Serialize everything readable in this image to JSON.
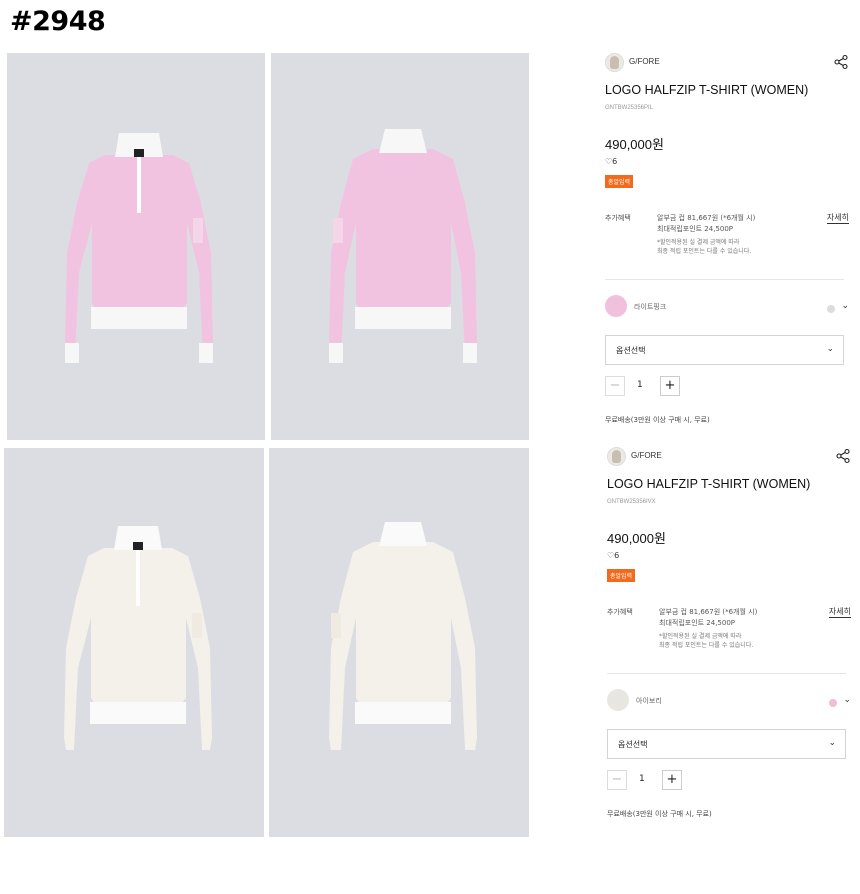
{
  "page_id": "#2948",
  "products": [
    {
      "brand": "G/FORE",
      "title": "LOGO HALFZIP T-SHIRT (WOMEN)",
      "code": "GNTBW25356PIL",
      "price": "490,000원",
      "likes": "6",
      "badge": "총알입력",
      "benefit_label": "추가혜택",
      "benefit_line1": "알부금 컵 81,667원 (*6개월 시)",
      "benefit_line2": "최대적립포인트 24,500P",
      "benefit_note1": "*할인적용된 실 결제 금액에 따라",
      "benefit_note2": "최종 적립 포인트는 다를 수 있습니다.",
      "detail_label": "자세히",
      "color_name": "라이트핑크",
      "option_label": "옵션선택",
      "qty": "1",
      "shipping": "무료배송(3만원 이상 구매 시, 무료)",
      "swatch_color": "#f0c0dc",
      "alt_color": "#dcdcdc"
    },
    {
      "brand": "G/FORE",
      "title": "LOGO HALFZIP T-SHIRT (WOMEN)",
      "code": "GNTBW25356IVX",
      "price": "490,000원",
      "likes": "6",
      "badge": "총알입력",
      "benefit_label": "추가혜택",
      "benefit_line1": "알부금 컵 81,667원 (*6개월 시)",
      "benefit_line2": "최대적립포인트 24,500P",
      "benefit_note1": "*할인적용된 실 결제 금액에 따라",
      "benefit_note2": "최종 적립 포인트는 다를 수 있습니다.",
      "detail_label": "자세히",
      "color_name": "아이보리",
      "option_label": "옵션선택",
      "qty": "1",
      "shipping": "무료배송(3만원 이상 구매 시, 무료)",
      "swatch_color": "#e8e6e0",
      "alt_color": "#f0bcd6"
    }
  ],
  "shirt_colors": {
    "pink": "#f2c3e0",
    "ivory": "#f4f1ea",
    "backdrop": "#dcdde2"
  }
}
